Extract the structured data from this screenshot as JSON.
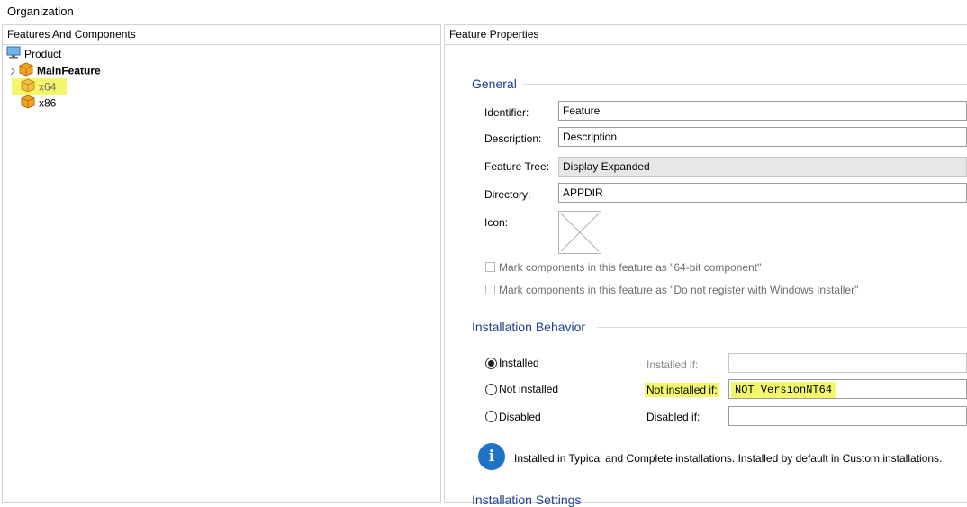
{
  "window": {
    "title": "Organization"
  },
  "left_panel": {
    "header": "Features And Components",
    "tree": [
      {
        "label": "Product",
        "bold": false,
        "highlighted": false,
        "icon": "computer-icon"
      },
      {
        "label": "MainFeature",
        "bold": true,
        "highlighted": false,
        "icon": "package-icon",
        "expander": "chevron-right-icon"
      },
      {
        "label": "x64",
        "bold": false,
        "highlighted": true,
        "icon": "package-icon"
      },
      {
        "label": "x86",
        "bold": false,
        "highlighted": false,
        "icon": "package-icon"
      }
    ]
  },
  "right_panel": {
    "header": "Feature Properties",
    "general": {
      "title": "General",
      "identifier": {
        "label": "Identifier:",
        "value": "Feature"
      },
      "description": {
        "label": "Description:",
        "value": "Description"
      },
      "feature_tree": {
        "label": "Feature Tree:",
        "value": "Display Expanded"
      },
      "directory": {
        "label": "Directory:",
        "value": "APPDIR"
      },
      "icon": {
        "label": "Icon:"
      },
      "check_64bit": {
        "label": "Mark components in this feature as \"64-bit component\"",
        "checked": false
      },
      "check_noregister": {
        "label": "Mark components in this feature as \"Do not register with Windows Installer\"",
        "checked": false
      }
    },
    "install_behavior": {
      "title": "Installation Behavior",
      "options": [
        {
          "label": "Installed",
          "selected": true,
          "cond_label": "Installed if:",
          "cond_value": ""
        },
        {
          "label": "Not installed",
          "selected": false,
          "cond_label": "Not installed if:",
          "cond_value": "NOT VersionNT64"
        },
        {
          "label": "Disabled",
          "selected": false,
          "cond_label": "Disabled if:",
          "cond_value": ""
        }
      ],
      "info_text": "Installed in Typical and Complete installations. Installed by default in Custom installations."
    },
    "next_section_partial": "Installation Settings"
  },
  "colors": {
    "highlight": "#f5f76a",
    "section_title": "#1f3f8f",
    "info_icon": "#1e73c8"
  }
}
